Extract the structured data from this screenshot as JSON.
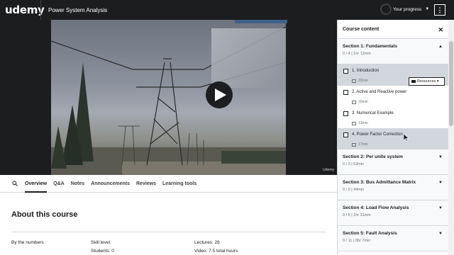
{
  "header": {
    "logo": "udemy",
    "course_title": "Power System Analysis",
    "progress_label": "Your progress",
    "menu_icon": "more-vertical-icon"
  },
  "video": {
    "play_icon": "play-icon",
    "watermark": "Udemy"
  },
  "tabs": [
    {
      "label": "Overview",
      "active": true
    },
    {
      "label": "Q&A"
    },
    {
      "label": "Notes"
    },
    {
      "label": "Announcements"
    },
    {
      "label": "Reviews"
    },
    {
      "label": "Learning tools"
    }
  ],
  "about": {
    "title": "About this course",
    "by_numbers": "By the numbers",
    "skill_level": "Skill level:",
    "students": "Students: 0",
    "lectures": "Lectures: 26",
    "video": "Video: 7.5 total hours"
  },
  "sidebar": {
    "title": "Course content",
    "close_icon": "close-icon",
    "sections": [
      {
        "title": "Section 1: Fundamentals",
        "meta": "0 / 4 | 1hr 12min",
        "expanded": true,
        "lectures": [
          {
            "title": "1. Introduction",
            "duration": "22min",
            "resources": "Resources"
          },
          {
            "title": "2. Active and Reactive power",
            "duration": "20min"
          },
          {
            "title": "3. Numerical Example",
            "duration": "13min"
          },
          {
            "title": "4. Power Factor Correction",
            "duration": "17min"
          }
        ]
      },
      {
        "title": "Section 2: Per unite system",
        "meta": "0 / 3 | 53min"
      },
      {
        "title": "Section 3: Bus Admittance Matrix",
        "meta": "0 / 2 | 44min"
      },
      {
        "title": "Section 4: Load Flow Analysis",
        "meta": "0 / 6 | 1hr 31min"
      },
      {
        "title": "Section 5: Fault Analysis",
        "meta": "0 / 11 | 3hr 7min"
      }
    ]
  }
}
